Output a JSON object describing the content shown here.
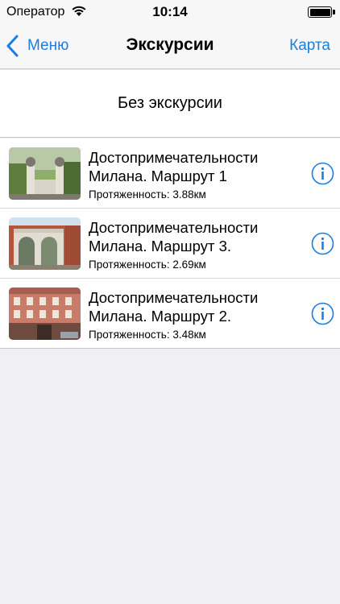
{
  "status_bar": {
    "carrier": "Оператор",
    "time": "10:14"
  },
  "nav": {
    "back_label": "Меню",
    "title": "Экскурсии",
    "map_label": "Карта"
  },
  "no_tour_label": "Без экскурсии",
  "routes": [
    {
      "title_line1": "Достопримечательности",
      "title_line2": "Милана. Маршрут 1",
      "length": "Протяженность: 3.88км"
    },
    {
      "title_line1": "Достопримечательности",
      "title_line2": "Милана. Маршрут 3.",
      "length": "Протяженность: 2.69км"
    },
    {
      "title_line1": "Достопримечательности",
      "title_line2": "Милана. Маршрут 2.",
      "length": "Протяженность: 3.48км"
    }
  ],
  "colors": {
    "accent": "#1a7ee0",
    "background": "#efeff4",
    "bar": "#f7f7f7"
  }
}
